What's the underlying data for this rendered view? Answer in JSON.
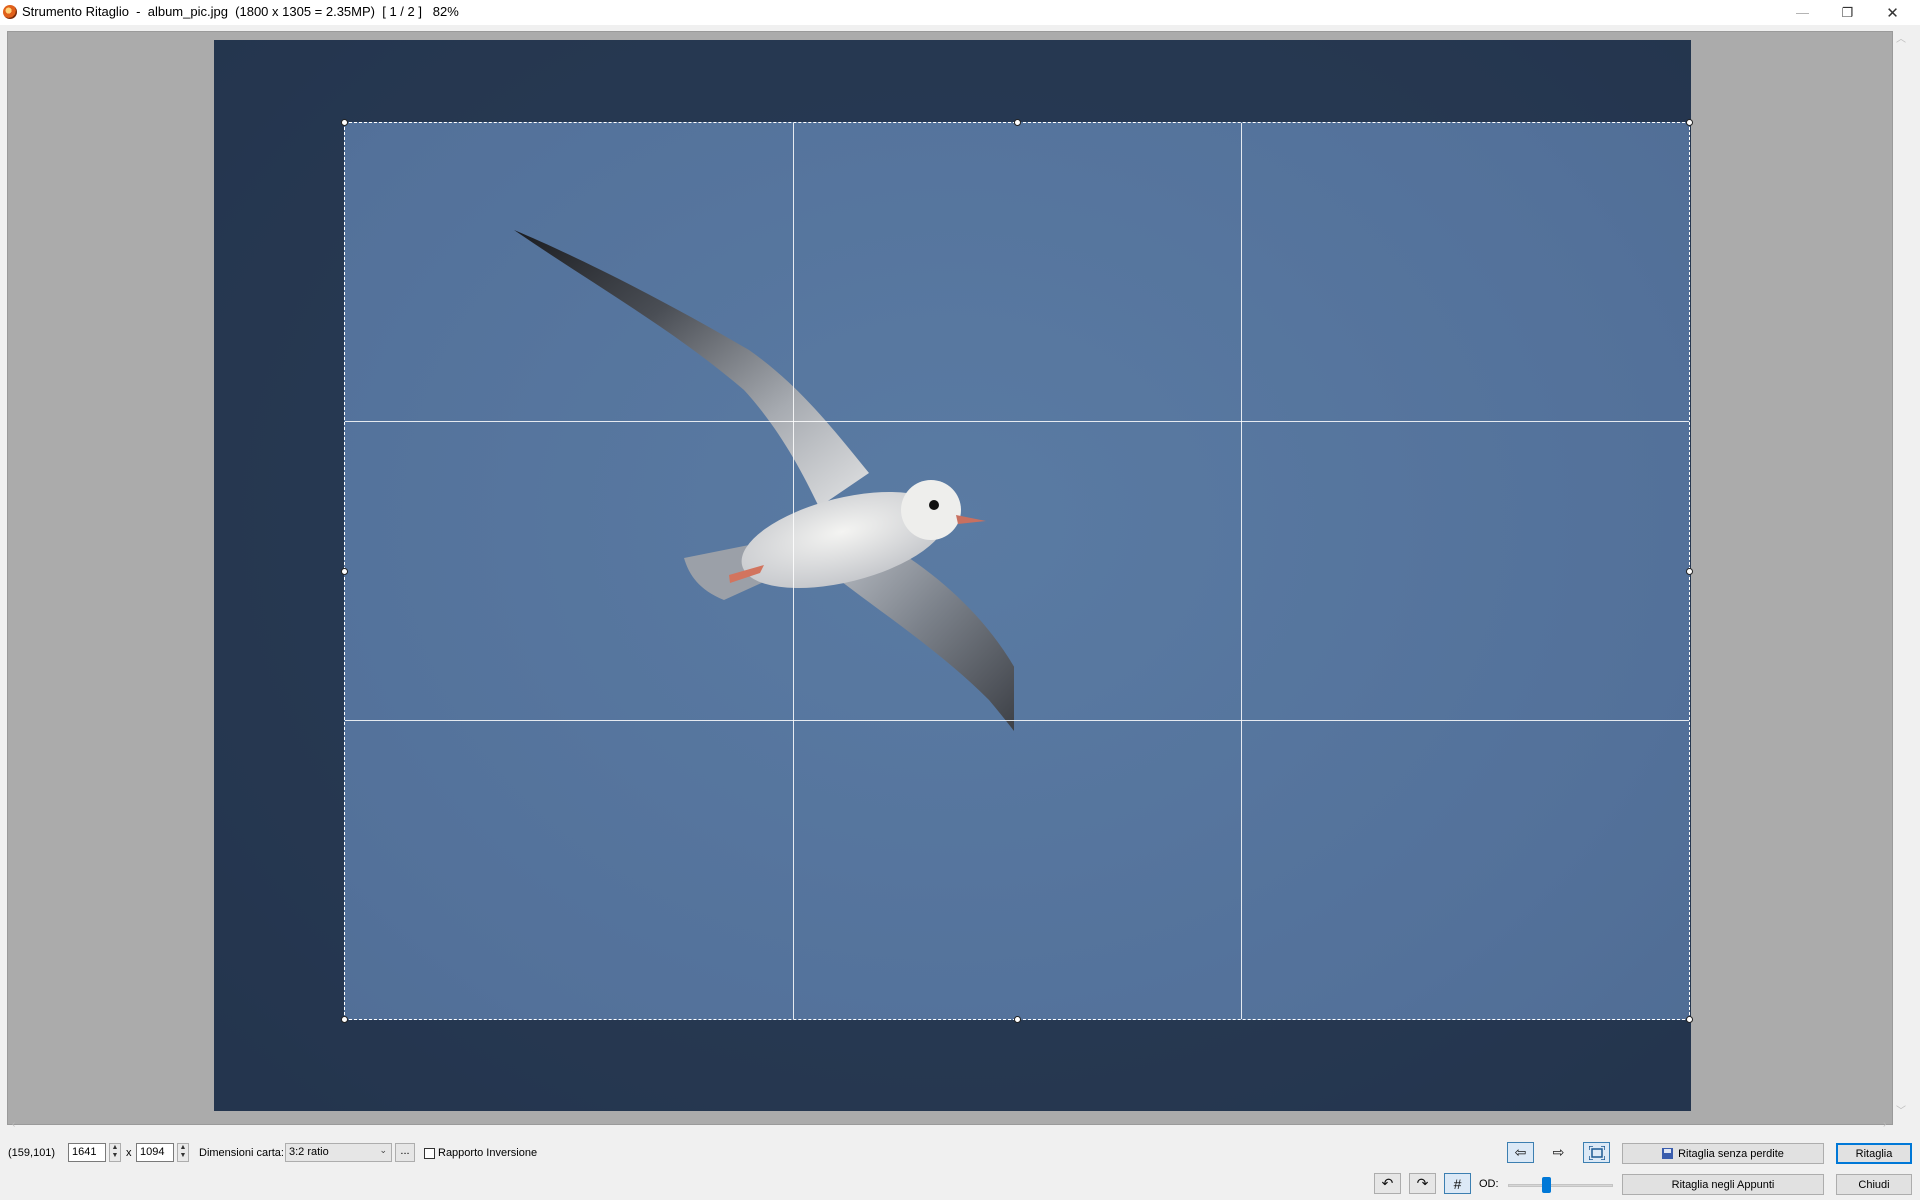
{
  "window": {
    "title": "Strumento Ritaglio  -  album_pic.jpg  (1800 x 1305 = 2.35MP)  [ 1 / 2 ]   82%",
    "minimize_glyph": "—",
    "maximize_glyph": "❐",
    "close_glyph": "✕"
  },
  "canvas": {
    "scroll_left_glyph": "‹",
    "scroll_right_glyph": "›",
    "scroll_up_glyph": "︿",
    "scroll_down_glyph": "﹀"
  },
  "controls": {
    "cursor_position": "(159,101)",
    "width_value": "1641",
    "times": "x",
    "height_value": "1094",
    "spin_up": "▲",
    "spin_down": "▼",
    "paper_size_label": "Dimensioni carta:",
    "paper_size_value": "3:2 ratio",
    "more_button": "...",
    "invert_ratio_label": "Rapporto Inversione",
    "invert_ratio_checked": false,
    "lossless_crop_button": "Ritaglia senza perdite",
    "crop_button": "Ritaglia",
    "crop_to_clipboard_button": "Ritaglia negli Appunti",
    "close_button": "Chiudi",
    "od_label": "OD:",
    "od_slider_value": 0.35,
    "prev_glyph": "⇦",
    "next_glyph": "⇨",
    "rotate_left_glyph": "↶",
    "rotate_right_glyph": "↷",
    "grid_glyph": "#"
  },
  "colors": {
    "accent": "#0078d7",
    "photo_sky": "#566f91",
    "canvas_bg": "#ababab"
  }
}
